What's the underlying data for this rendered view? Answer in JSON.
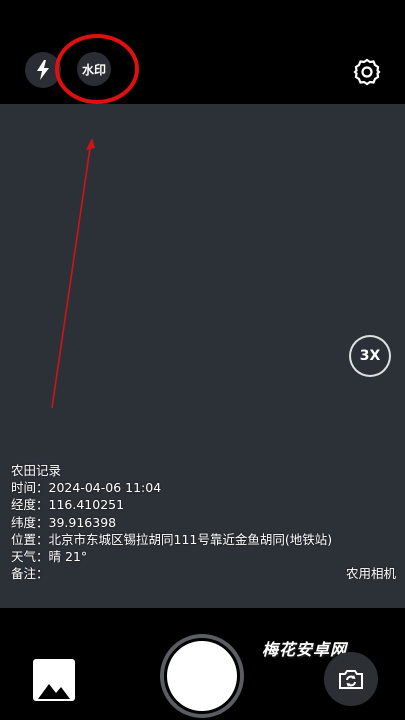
{
  "top_bar": {
    "flash_icon": "lightning-bolt-icon",
    "watermark_button_label": "水印",
    "settings_icon": "gear-icon",
    "highlight_color": "#e01010"
  },
  "viewfinder": {
    "background": "#2c3138",
    "zoom_label": "3X"
  },
  "watermark_info": {
    "title": "农田记录",
    "rows": [
      {
        "label": "时间：",
        "value": "2024-04-06 11:04"
      },
      {
        "label": "经度：",
        "value": "116.410251"
      },
      {
        "label": "纬度：",
        "value": "39.916398"
      },
      {
        "label": "位置：",
        "value": "北京市东城区锡拉胡同111号靠近金鱼胡同(地铁站)"
      },
      {
        "label": "天气：",
        "value": "晴 21°"
      },
      {
        "label": "备注：",
        "value": ""
      }
    ],
    "brand": "农用相机"
  },
  "bottom_bar": {
    "gallery_icon": "image-gallery-icon",
    "shutter_icon": "shutter-button",
    "switch_icon": "camera-switch-icon"
  },
  "site_watermark": "梅花安卓网"
}
